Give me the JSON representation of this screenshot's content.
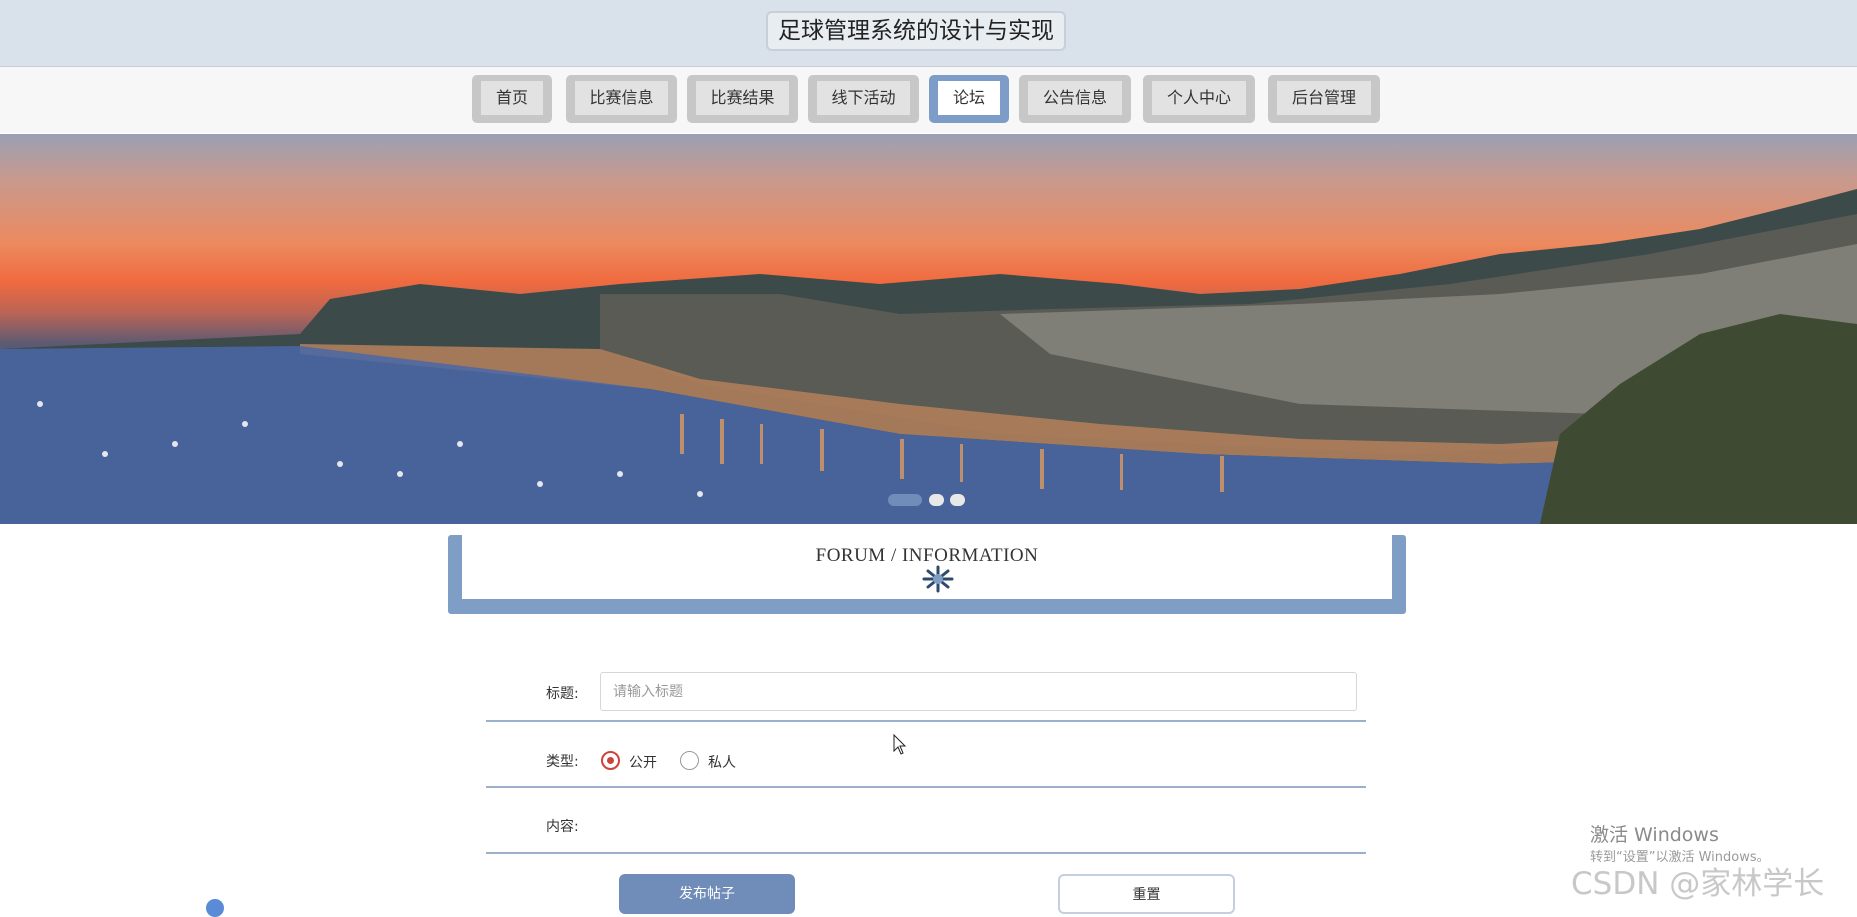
{
  "header": {
    "title": "足球管理系统的设计与实现"
  },
  "nav": {
    "items": [
      {
        "label": "首页"
      },
      {
        "label": "比赛信息"
      },
      {
        "label": "比赛结果"
      },
      {
        "label": "线下活动"
      },
      {
        "label": "论坛",
        "active": true
      },
      {
        "label": "公告信息"
      },
      {
        "label": "个人中心"
      },
      {
        "label": "后台管理"
      }
    ]
  },
  "banner": {
    "slide_count": 3,
    "active_slide": 1
  },
  "section": {
    "title": "FORUM / INFORMATION"
  },
  "form": {
    "title_label": "标题:",
    "title_placeholder": "请输入标题",
    "title_value": "",
    "type_label": "类型:",
    "type_options": [
      "公开",
      "私人"
    ],
    "type_selected": "公开",
    "content_label": "内容:",
    "submit_label": "发布帖子",
    "reset_label": "重置"
  },
  "overlay": {
    "activation_title": "激活 Windows",
    "activation_hint": "转到“设置”以激活 Windows。",
    "csdn_watermark": "CSDN @家林学长"
  },
  "colors": {
    "accent": "#7f9ec6",
    "radio": "#d0413a",
    "button": "#6f8db8"
  }
}
